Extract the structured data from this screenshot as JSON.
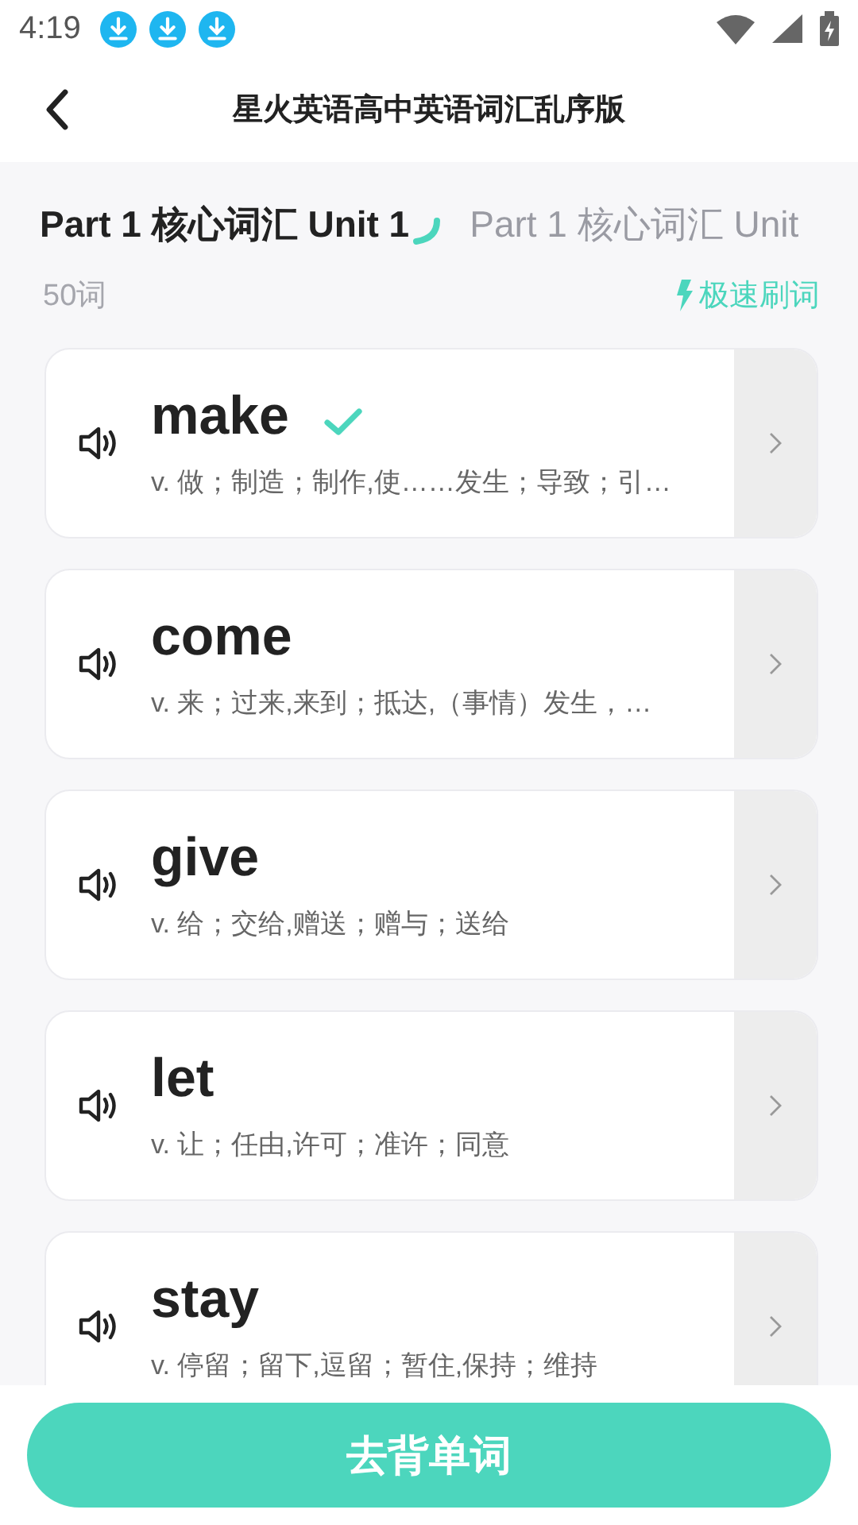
{
  "status_bar": {
    "time": "4:19",
    "notifications": [
      {
        "kind": "download"
      },
      {
        "kind": "download"
      },
      {
        "kind": "download"
      }
    ]
  },
  "header": {
    "title": "星火英语高中英语词汇乱序版"
  },
  "tabs": [
    {
      "label": "Part 1 核心词汇 Unit 1",
      "selected": true
    },
    {
      "label": "Part 1 核心词汇 Unit",
      "selected": false
    }
  ],
  "word_count": "50词",
  "speed_link": "极速刷词",
  "words": [
    {
      "word": "make",
      "meaning": "v. 做；制造；制作,使……发生；导致；引…",
      "learned": true
    },
    {
      "word": "come",
      "meaning": "v. 来；过来,来到；抵达,（事情）发生，…",
      "learned": false
    },
    {
      "word": "give",
      "meaning": "v. 给；交给,赠送；赠与；送给",
      "learned": false
    },
    {
      "word": "let",
      "meaning": "v. 让；任由,许可；准许；同意",
      "learned": false
    },
    {
      "word": "stay",
      "meaning": "v. 停留；留下,逗留；暂住,保持；维持",
      "learned": false
    }
  ],
  "primary_button": "去背单词"
}
